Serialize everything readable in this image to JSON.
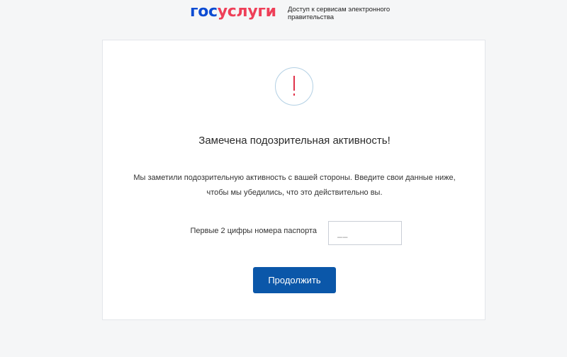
{
  "header": {
    "logo_part1": "гос",
    "logo_part2": "услуги",
    "tagline": "Доступ к сервисам электронного правительства"
  },
  "card": {
    "icon": "exclamation-icon",
    "title": "Замечена подозрительная активность!",
    "description_line1": "Мы заметили подозрительную активность с вашей стороны. Введите свои данные ниже,",
    "description_line2": "чтобы мы убедились, что это действительно вы.",
    "field_label": "Первые 2 цифры номера паспорта",
    "field_placeholder": "__",
    "field_value": "",
    "button_label": "Продолжить"
  },
  "colors": {
    "brand_blue": "#0d4cd3",
    "brand_red": "#ee3f58",
    "button": "#0b57a9",
    "alert": "#e0324a"
  }
}
